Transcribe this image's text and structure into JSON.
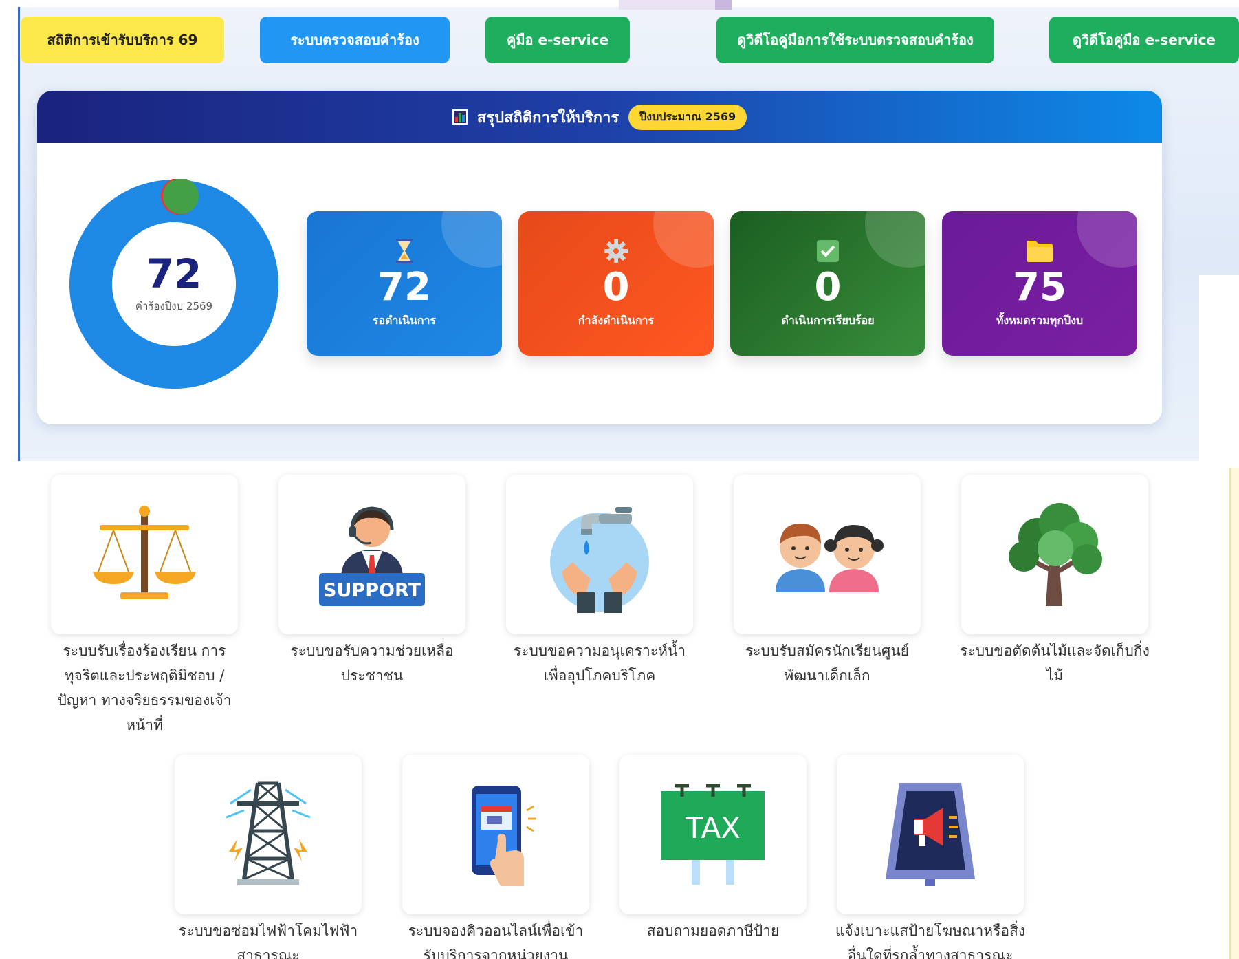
{
  "top_buttons": {
    "stats": "สถิติการเข้ารับบริการ 69",
    "check_request": "ระบบตรวจสอบคำร้อง",
    "manual": "คู่มือ e-service",
    "video_check": "ดูวิดีโอคู่มือการใช้ระบบตรวจสอบคำร้อง",
    "video_manual": "ดูวิดีโอคู่มือ e-service"
  },
  "summary": {
    "title": "สรุปสถิติการให้บริการ",
    "budget_badge": "ปีงบประมาณ 2569",
    "donut": {
      "value": "72",
      "caption": "คำร้องปีงบ 2569"
    },
    "stats": [
      {
        "value": "72",
        "label": "รอดำเนินการ",
        "icon": "hourglass-icon"
      },
      {
        "value": "0",
        "label": "กำลังดำเนินการ",
        "icon": "gear-icon"
      },
      {
        "value": "0",
        "label": "ดำเนินการเรียบร้อย",
        "icon": "check-icon"
      },
      {
        "value": "75",
        "label": "ทั้งหมดรวมทุกปีงบ",
        "icon": "folder-icon"
      }
    ],
    "colors": {
      "waiting": "#1e88e5",
      "in_progress": "#ff5722",
      "done": "#388e3c",
      "total": "#7b1fa2"
    }
  },
  "services_row1": [
    {
      "label": "ระบบรับเรื่องร้องเรียน การ\nทุจริตและประพฤติมิชอบ /\nปัญหา ทางจริยธรรมของเจ้า\nหน้าที่",
      "icon": "scales-icon"
    },
    {
      "label": "ระบบขอรับความช่วยเหลือ\nประชาชน",
      "icon": "support-agent-icon",
      "icon_text": "SUPPORT"
    },
    {
      "label": "ระบบขอความอนุเคราะห์น้ำ\nเพื่ออุปโภคบริโภค",
      "icon": "water-tap-icon"
    },
    {
      "label": "ระบบรับสมัครนักเรียนศูนย์\nพัฒนาเด็กเล็ก",
      "icon": "children-icon"
    },
    {
      "label": "ระบบขอตัดต้นไม้และจัดเก็บกิ่ง\nไม้",
      "icon": "tree-icon"
    }
  ],
  "services_row2": [
    {
      "label": "ระบบขอซ่อมไฟฟ้าโคมไฟฟ้า\nสาธารณะ",
      "icon": "power-tower-icon"
    },
    {
      "label": "ระบบจองคิวออนไลน์เพื่อเข้า\nรับบริการจากหน่วยงาน",
      "icon": "phone-booking-icon"
    },
    {
      "label": "สอบถามยอดภาษีป้าย",
      "icon": "tax-sign-icon",
      "icon_text": "TAX"
    },
    {
      "label": "แจ้งเบาะแสป้ายโฆษณาหรือสิ่ง\nอื่นใดที่รุกล้ำทางสาธารณะ",
      "icon": "megaphone-sign-icon"
    }
  ]
}
